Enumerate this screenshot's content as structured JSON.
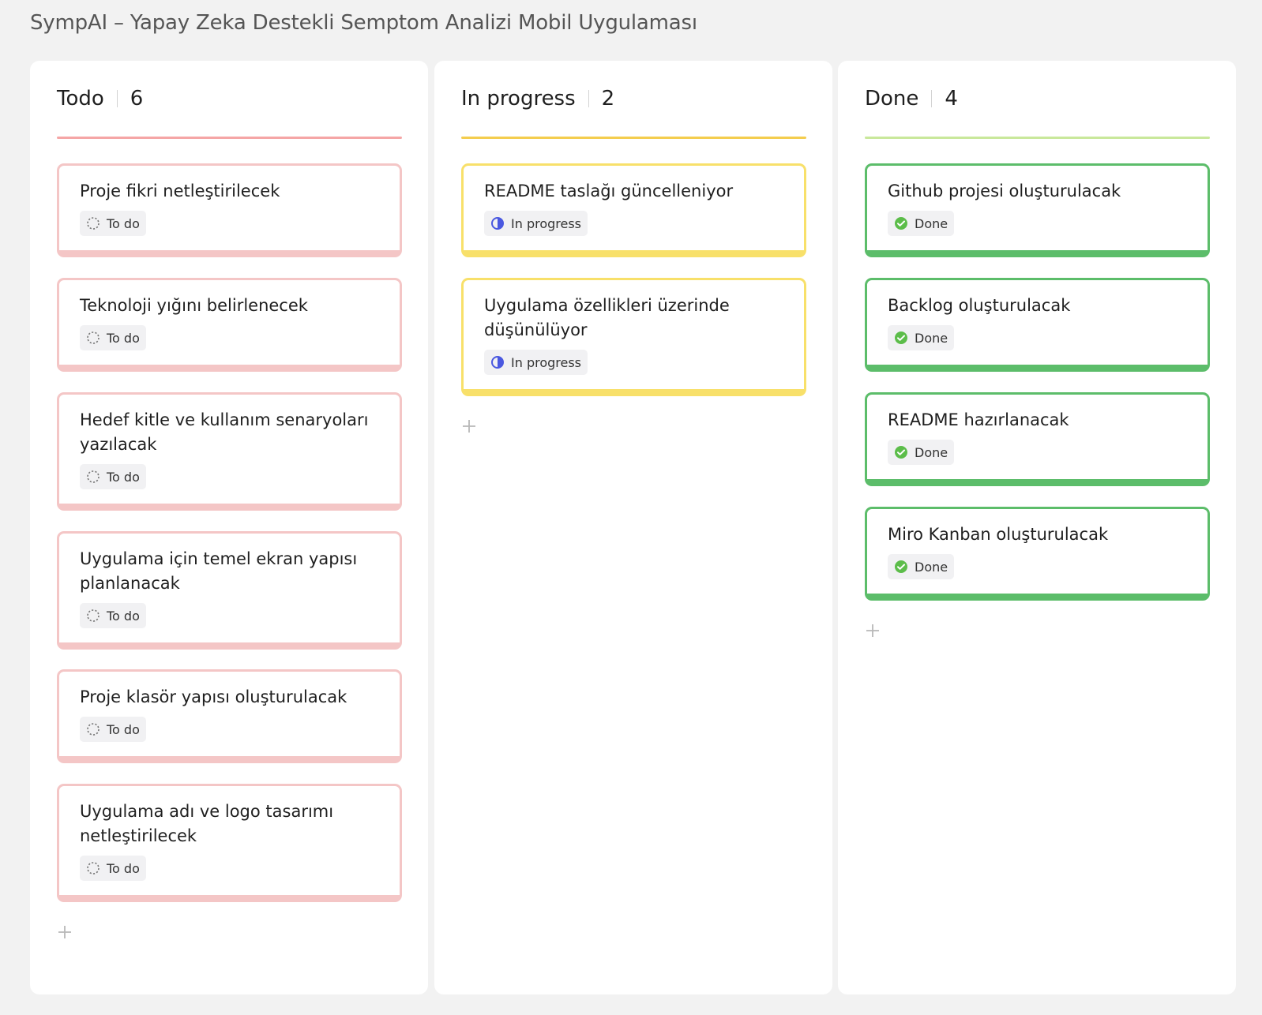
{
  "board_title": "SympAI – Yapay Zeka Destekli Semptom Analizi Mobil Uygulaması",
  "colors": {
    "todo_accent": "#f5a6a6",
    "todo_card_border": "#f4c6c6",
    "progress_accent": "#f4cd4e",
    "progress_card_border": "#f8e06a",
    "done_accent": "#c9e89b",
    "done_card_border": "#5cbd6a",
    "progress_icon": "#4a58e0",
    "done_icon": "#5cbd4a"
  },
  "columns": [
    {
      "name": "Todo",
      "count": "6",
      "add_icon": "plus-icon",
      "cards": [
        {
          "title": "Proje fikri netleştirilecek",
          "status": "To do",
          "icon": "dashed-circle-icon"
        },
        {
          "title": "Teknoloji yığını belirlenecek",
          "status": "To do",
          "icon": "dashed-circle-icon"
        },
        {
          "title": "Hedef kitle ve kullanım senaryoları yazılacak",
          "status": "To do",
          "icon": "dashed-circle-icon"
        },
        {
          "title": "Uygulama için temel ekran yapısı planlanacak",
          "status": "To do",
          "icon": "dashed-circle-icon"
        },
        {
          "title": "Proje klasör yapısı oluşturulacak",
          "status": "To do",
          "icon": "dashed-circle-icon"
        },
        {
          "title": "Uygulama adı ve logo tasarımı netleştirilecek",
          "status": "To do",
          "icon": "dashed-circle-icon"
        }
      ]
    },
    {
      "name": "In progress",
      "count": "2",
      "add_icon": "plus-icon",
      "cards": [
        {
          "title": "README taslağı güncelleniyor",
          "status": "In progress",
          "icon": "half-circle-icon"
        },
        {
          "title": "Uygulama özellikleri üzerinde düşünülüyor",
          "status": "In progress",
          "icon": "half-circle-icon"
        }
      ]
    },
    {
      "name": "Done",
      "count": "4",
      "add_icon": "plus-icon",
      "cards": [
        {
          "title": "Github projesi oluşturulacak",
          "status": "Done",
          "icon": "check-circle-icon"
        },
        {
          "title": "Backlog oluşturulacak",
          "status": "Done",
          "icon": "check-circle-icon"
        },
        {
          "title": "README hazırlanacak",
          "status": "Done",
          "icon": "check-circle-icon"
        },
        {
          "title": "Miro Kanban oluşturulacak",
          "status": "Done",
          "icon": "check-circle-icon"
        }
      ]
    }
  ]
}
